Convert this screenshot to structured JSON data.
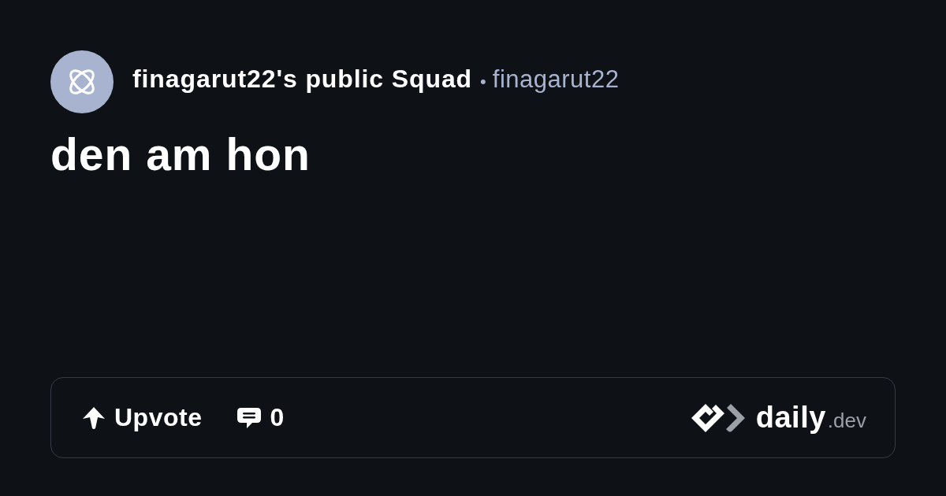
{
  "squad": {
    "name": "finagarut22's public Squad",
    "separator": "•",
    "handle": "finagarut22"
  },
  "post": {
    "title": "den am hon"
  },
  "actions": [
    {
      "kind": "upvote",
      "label": "Upvote"
    },
    {
      "kind": "comments",
      "label": "0"
    }
  ],
  "brand": {
    "name": "daily",
    "suffix": ".dev"
  }
}
